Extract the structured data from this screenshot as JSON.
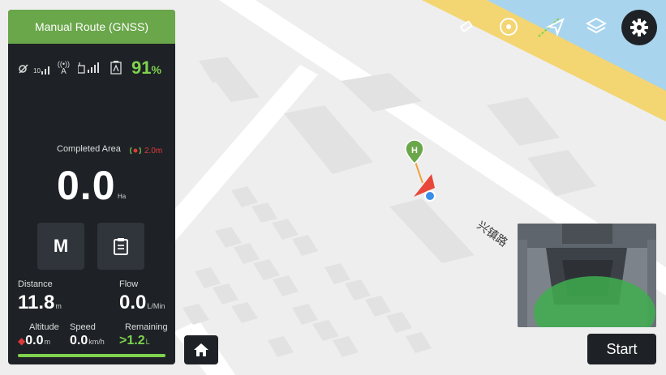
{
  "header": {
    "title": "Manual Route (GNSS)"
  },
  "status": {
    "gnss_count": "10",
    "rtk_label": "A",
    "battery_percent": "91",
    "battery_unit": "%"
  },
  "area": {
    "label": "Completed Area",
    "spray_width": "2.0m",
    "value": "0.0",
    "unit": "Ha"
  },
  "mode_button": {
    "label": "M"
  },
  "metrics": {
    "distance": {
      "label": "Distance",
      "value": "11.8",
      "unit": "m"
    },
    "flow": {
      "label": "Flow",
      "value": "0.0",
      "unit": "L/Min"
    },
    "altitude": {
      "label": "Altitude",
      "value": "0.0",
      "unit": "m"
    },
    "speed": {
      "label": "Speed",
      "value": "0.0",
      "unit": "km/h"
    },
    "remaining": {
      "label": "Remaining",
      "prefix": ">",
      "value": "1.2",
      "unit": "L"
    }
  },
  "progress": {
    "fraction": 1.0
  },
  "map": {
    "home_marker": "H",
    "street_name": "兴镇路"
  },
  "actions": {
    "start_label": "Start"
  },
  "icons": [
    "eraser-icon",
    "compass-icon",
    "navigation-arrow-icon",
    "layers-icon",
    "gear-icon",
    "home-icon",
    "clipboard-icon",
    "satellite-icon",
    "rtk-antenna-icon",
    "remote-signal-icon",
    "battery-icon"
  ],
  "colors": {
    "accent": "#6aa64a",
    "panel": "#1e2226",
    "battery_green": "#7fd34e",
    "alert_red": "#e03a3a",
    "route_yellow": "#f3d572",
    "water_blue": "#a9d4ee"
  }
}
